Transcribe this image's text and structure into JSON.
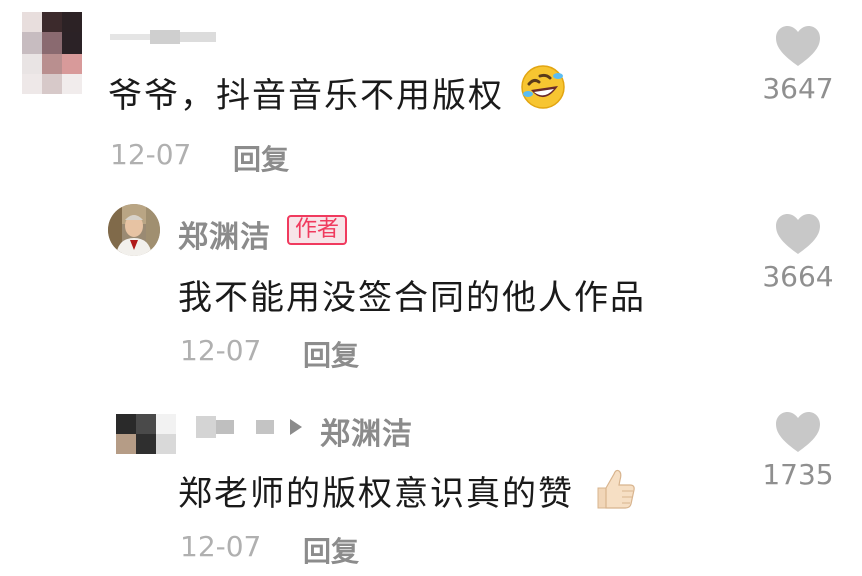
{
  "comments": [
    {
      "text": "爷爷，抖音音乐不用版权",
      "emoji": "rofl-emoji",
      "date": "12-07",
      "reply_label": "回复",
      "likes": "3647"
    },
    {
      "username": "郑渊洁",
      "badge": "作者",
      "text": "我不能用没签合同的他人作品",
      "date": "12-07",
      "reply_label": "回复",
      "likes": "3664"
    },
    {
      "reply_to": "郑渊洁",
      "text": "郑老师的版权意识真的赞",
      "emoji": "thumbs-up-emoji",
      "date": "12-07",
      "reply_label": "回复",
      "likes": "1735"
    }
  ],
  "colors": {
    "like_icon": "#c8c8c8",
    "badge_red": "#f03a5e",
    "text": "#1a1a1a",
    "muted": "#8b8b8b"
  }
}
